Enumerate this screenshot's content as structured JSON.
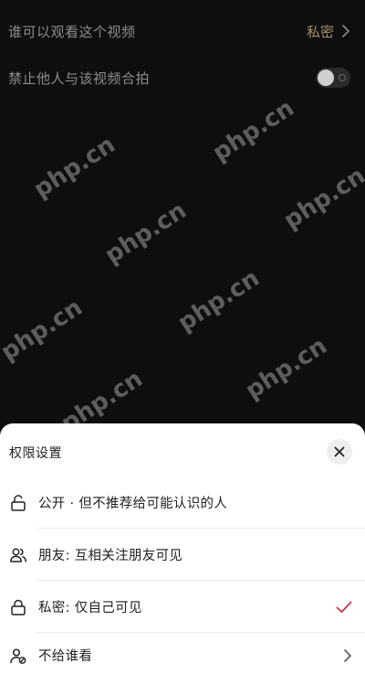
{
  "settings": {
    "who_can_watch_label": "谁可以观看这个视频",
    "who_can_watch_value": "私密",
    "disable_duet_label": "禁止他人与该视频合拍",
    "disable_duet_on": false
  },
  "watermark": "php.cn",
  "sheet": {
    "title": "权限设置",
    "options": [
      {
        "label": "公开 · 但不推荐给可能认识的人",
        "icon": "unlock-icon",
        "selected": false
      },
      {
        "label": "朋友: 互相关注朋友可见",
        "icon": "friends-icon",
        "selected": false
      },
      {
        "label": "私密: 仅自己可见",
        "icon": "lock-icon",
        "selected": true
      },
      {
        "label": "不给谁看",
        "icon": "user-block-icon",
        "selected": false
      }
    ]
  },
  "colors": {
    "background": "#0e0e0f",
    "accent_value": "#a8906a",
    "check": "#c2344f"
  }
}
